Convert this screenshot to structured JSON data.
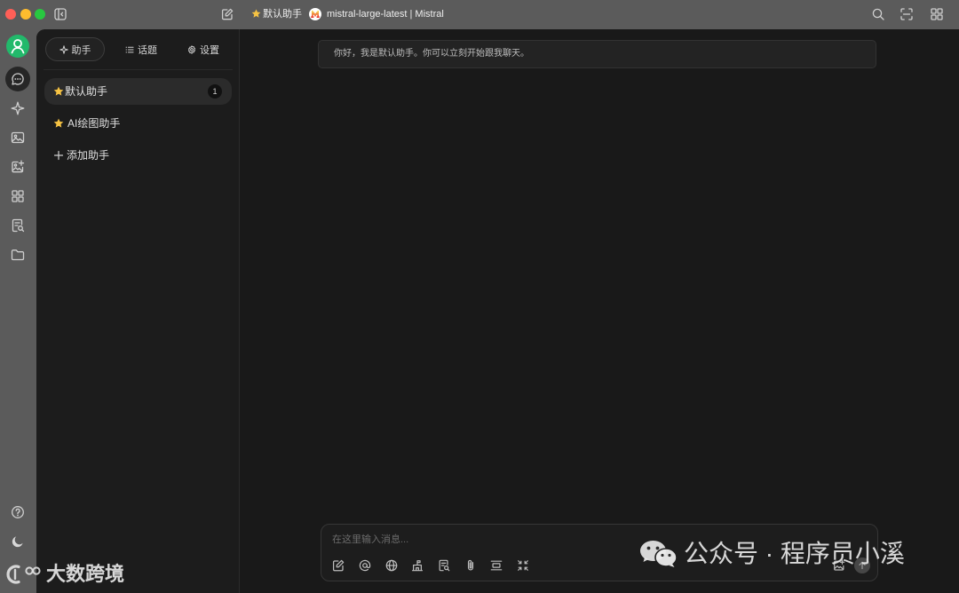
{
  "titlebar": {
    "assistant_name": "默认助手",
    "assistant_icon": "star-icon",
    "model_name": "mistral-large-latest | Mistral",
    "model_icon": "mistral-logo",
    "left_icons": [
      "sidebar-toggle-icon",
      "edit-icon"
    ],
    "right_icons": [
      "search-icon",
      "expand-icon",
      "grid-icon"
    ]
  },
  "nav": {
    "top": [
      "user-avatar",
      "chat-icon",
      "sparkle-icon",
      "image-icon",
      "image-plus-icon",
      "apps-grid-icon",
      "document-search-icon",
      "folder-icon"
    ],
    "bottom": [
      "help-icon",
      "moon-icon"
    ],
    "active": "chat-icon"
  },
  "assistant_panel": {
    "tabs": [
      {
        "label": "助手",
        "icon": "sparkle-icon",
        "selected": true
      },
      {
        "label": "话题",
        "icon": "list-icon",
        "selected": false
      },
      {
        "label": "设置",
        "icon": "gear-icon",
        "selected": false
      }
    ],
    "assistants": [
      {
        "label": "默认助手",
        "icon": "star-icon",
        "badge": "1",
        "selected": true
      },
      {
        "label": "AI绘图助手",
        "icon": "star-icon",
        "selected": false
      }
    ],
    "add_label": "添加助手",
    "add_icon": "plus-icon"
  },
  "chat": {
    "greeting": "你好，我是默认助手。你可以立刻开始跟我聊天。",
    "input_placeholder": "在这里输入消息...",
    "toolbar_icons": [
      "edit-icon",
      "at-icon",
      "globe-icon",
      "library-icon",
      "document-search-icon",
      "paperclip-icon",
      "align-icon",
      "collapse-icon"
    ],
    "right_icons": [
      "image-plus-icon",
      "send-icon"
    ]
  },
  "watermarks": {
    "wechat_text": "公众号 · 程序员小溪",
    "wechat_icon": "wechat-logo",
    "brand_text": "大数跨境",
    "brand_icon": "brand-logo"
  },
  "colors": {
    "chrome": "#5b5b5b",
    "accent": "#22b96b",
    "star": "#f6c343",
    "close": "#ff5f57",
    "minimize": "#febc2e",
    "maximize": "#28c840"
  }
}
